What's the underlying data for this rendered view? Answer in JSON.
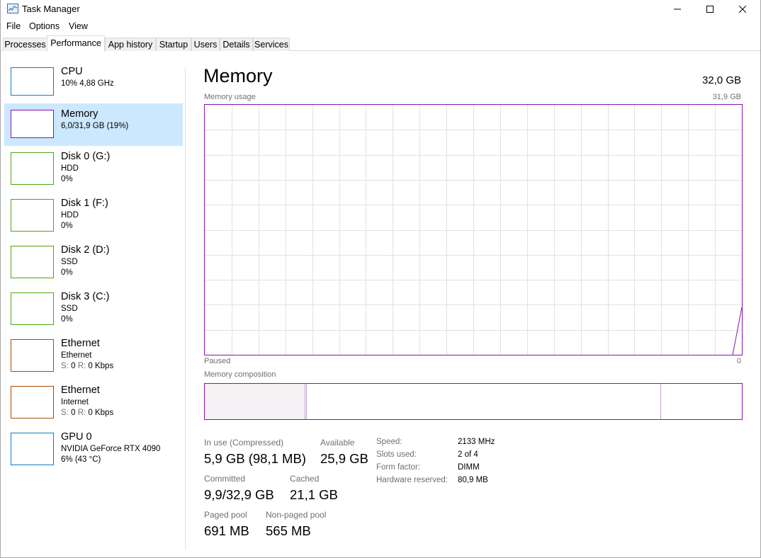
{
  "window": {
    "title": "Task Manager"
  },
  "menu": [
    "File",
    "Options",
    "View"
  ],
  "tabs": [
    "Processes",
    "Performance",
    "App history",
    "Startup",
    "Users",
    "Details",
    "Services"
  ],
  "active_tab": "Performance",
  "resources": [
    {
      "name": "CPU",
      "line1": "10%  4,88 GHz",
      "line2": "",
      "color": "#117dbb"
    },
    {
      "name": "Memory",
      "line1": "6,0/31,9 GB (19%)",
      "line2": "",
      "color": "#8b12ae"
    },
    {
      "name": "Disk 0 (G:)",
      "line1": "HDD",
      "line2": "0%",
      "color": "#4da60c"
    },
    {
      "name": "Disk 1 (F:)",
      "line1": "HDD",
      "line2": "0%",
      "color": "#4da60c"
    },
    {
      "name": "Disk 2 (D:)",
      "line1": "SSD",
      "line2": "0%",
      "color": "#4da60c"
    },
    {
      "name": "Disk 3 (C:)",
      "line1": "SSD",
      "line2": "0%",
      "color": "#4da60c"
    },
    {
      "name": "Ethernet",
      "line1": "Ethernet",
      "s_label": "S:",
      "s_value": "0",
      "r_label": "R:",
      "r_value": "0 Kbps",
      "color": "#a74f01"
    },
    {
      "name": "Ethernet",
      "line1": "Internet",
      "s_label": "S:",
      "s_value": "0",
      "r_label": "R:",
      "r_value": "0 Kbps",
      "color": "#a74f01"
    },
    {
      "name": "GPU 0",
      "line1": "NVIDIA GeForce RTX 4090",
      "line2": "6% (43 °C)",
      "color": "#117dbb"
    }
  ],
  "detail": {
    "title": "Memory",
    "total": "32,0 GB",
    "usage_label": "Memory usage",
    "usage_max": "31,9 GB",
    "paused_label": "Paused",
    "zero_label": "0",
    "composition_label": "Memory composition",
    "composition_in_use_fraction": 0.187,
    "composition_modified_fraction": 0.003,
    "composition_standby_fraction": 0.66,
    "graph_color": "#8b12ae",
    "graph_tail_level": 0.19,
    "stats": {
      "in_use_label": "In use (Compressed)",
      "in_use_value": "5,9 GB (98,1 MB)",
      "available_label": "Available",
      "available_value": "25,9 GB",
      "committed_label": "Committed",
      "committed_value": "9,9/32,9 GB",
      "cached_label": "Cached",
      "cached_value": "21,1 GB",
      "paged_label": "Paged pool",
      "paged_value": "691 MB",
      "nonpaged_label": "Non-paged pool",
      "nonpaged_value": "565 MB"
    },
    "specs": [
      {
        "label": "Speed:",
        "value": "2133 MHz"
      },
      {
        "label": "Slots used:",
        "value": "2 of 4"
      },
      {
        "label": "Form factor:",
        "value": "DIMM"
      },
      {
        "label": "Hardware reserved:",
        "value": "80,9 MB"
      }
    ]
  }
}
